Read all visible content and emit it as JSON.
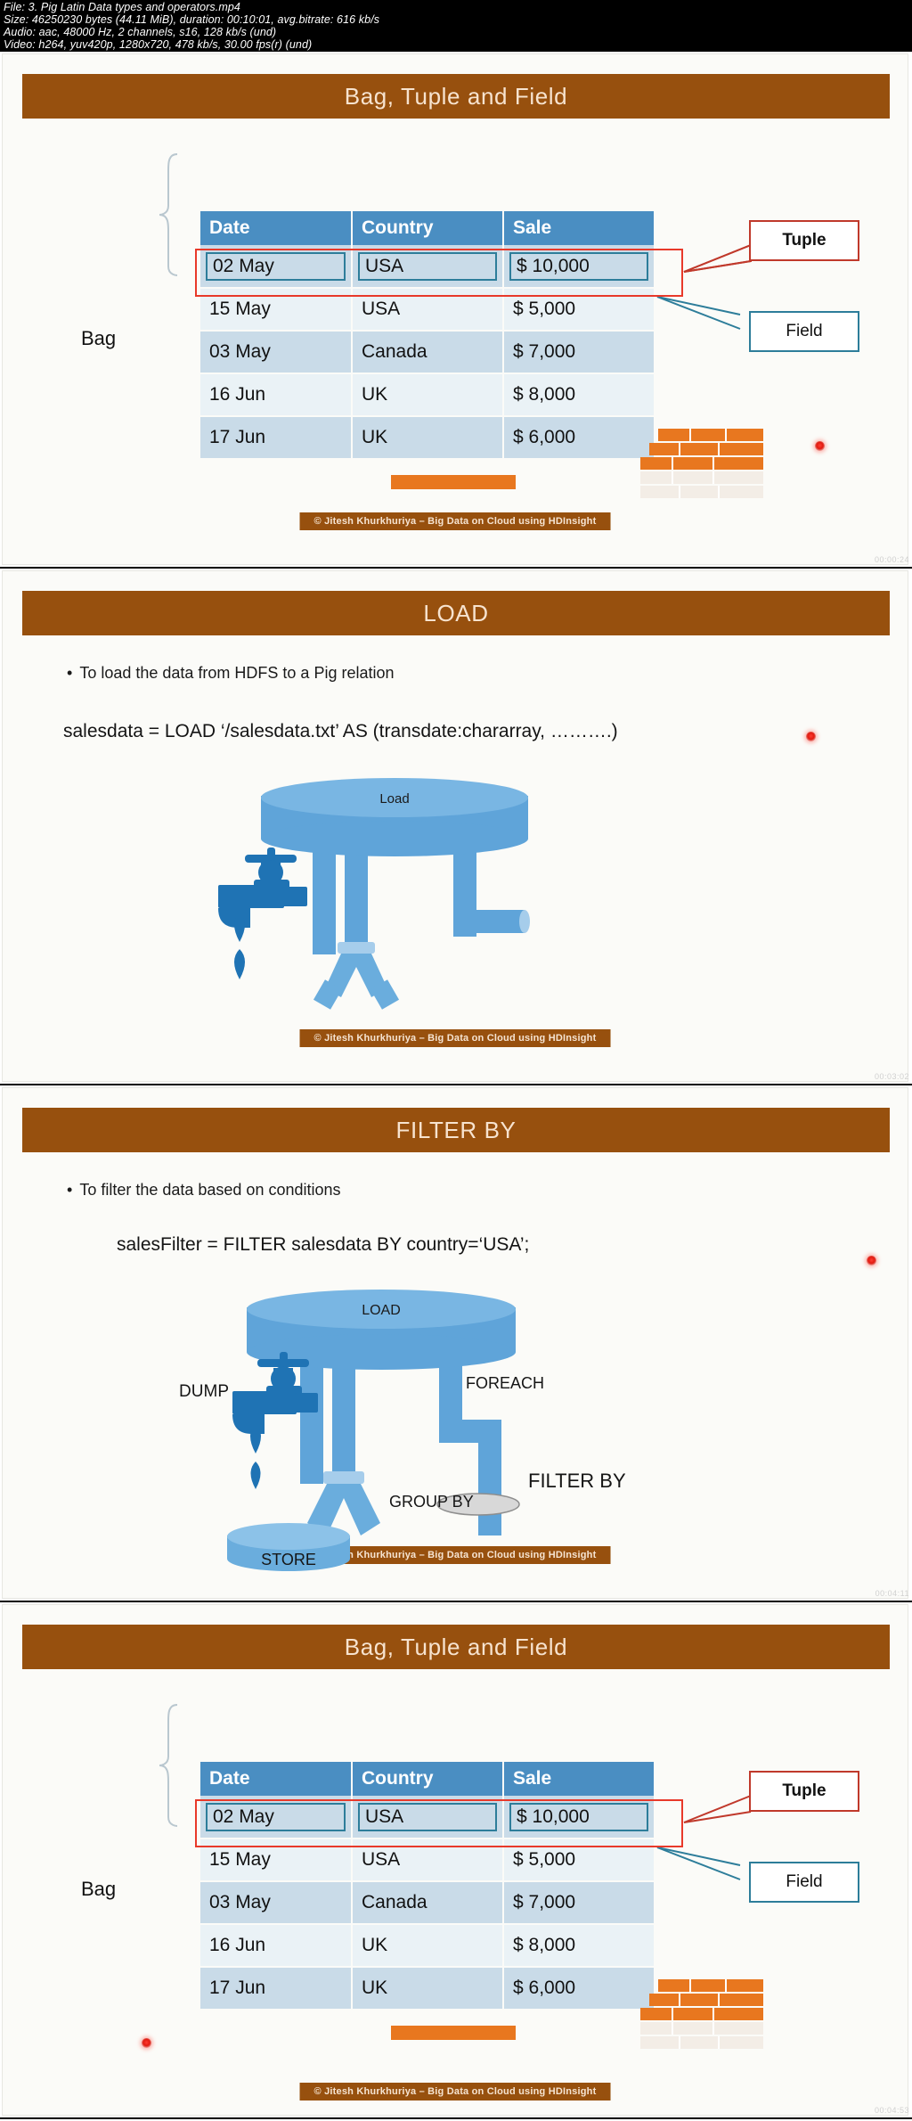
{
  "meta": {
    "file_line": "File: 3. Pig Latin Data types and operators.mp4",
    "size_line": "Size: 46250230 bytes (44.11 MiB), duration: 00:10:01, avg.bitrate: 616 kb/s",
    "audio_line": "Audio: aac, 48000 Hz, 2 channels, s16, 128 kb/s (und)",
    "video_line": "Video: h264, yuv420p, 1280x720, 478 kb/s, 30.00 fps(r) (und)"
  },
  "common": {
    "footer": "© Jitesh Khurkhuriya – Big Data on Cloud using HDInsight",
    "bullet_glyph": "•",
    "accent_brown": "#97500e",
    "table_header_blue": "#4a8ec2",
    "highlight_red": "#e8392a",
    "field_teal": "#2d7d9a"
  },
  "slides": [
    {
      "title": "Bag, Tuple and Field",
      "timecode": "00:00:24",
      "bag_label": "Bag",
      "tuple_label": "Tuple",
      "field_label": "Field",
      "table": {
        "columns": [
          "Date",
          "Country",
          "Sale"
        ],
        "rows": [
          [
            "02 May",
            "USA",
            "$ 10,000"
          ],
          [
            "15 May",
            "USA",
            "$ 5,000"
          ],
          [
            "03 May",
            "Canada",
            "$ 7,000"
          ],
          [
            "16 Jun",
            "UK",
            "$ 8,000"
          ],
          [
            "17 Jun",
            "UK",
            "$ 6,000"
          ]
        ]
      }
    },
    {
      "title": "LOAD",
      "timecode": "00:03:02",
      "bullet": "To load the data from HDFS to a Pig relation",
      "code": "salesdata  =   LOAD  ‘/salesdata.txt’  AS (transdate:chararray, ……….)",
      "diagram": {
        "tank_label": "Load"
      }
    },
    {
      "title": "FILTER BY",
      "timecode": "00:04:11",
      "bullet": "To filter the data based on conditions",
      "code": "salesFilter = FILTER salesdata BY country=‘USA’;",
      "diagram": {
        "tank_label": "LOAD",
        "dump_label": "DUMP",
        "store_label": "STORE",
        "group_label": "GROUP BY",
        "foreach_label": "FOREACH",
        "filter_label": "FILTER BY"
      }
    },
    {
      "title": "Bag, Tuple and Field",
      "timecode": "00:04:53",
      "bag_label": "Bag",
      "tuple_label": "Tuple",
      "field_label": "Field",
      "table": {
        "columns": [
          "Date",
          "Country",
          "Sale"
        ],
        "rows": [
          [
            "02 May",
            "USA",
            "$ 10,000"
          ],
          [
            "15 May",
            "USA",
            "$ 5,000"
          ],
          [
            "03 May",
            "Canada",
            "$ 7,000"
          ],
          [
            "16 Jun",
            "UK",
            "$ 8,000"
          ],
          [
            "17 Jun",
            "UK",
            "$ 6,000"
          ]
        ]
      }
    }
  ]
}
